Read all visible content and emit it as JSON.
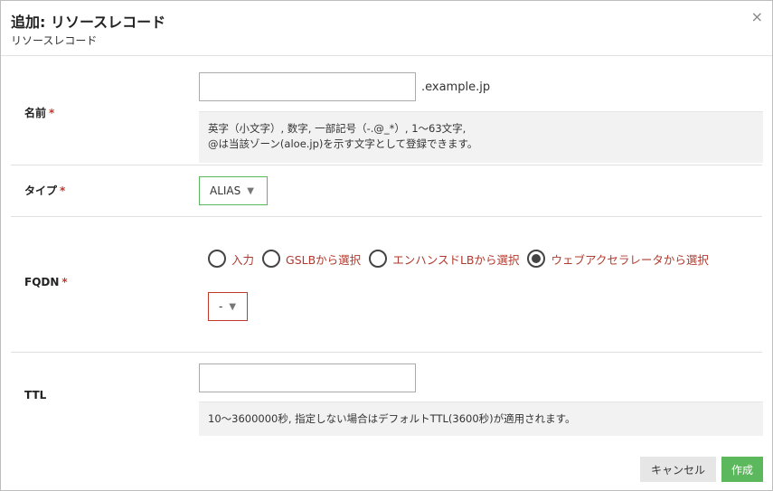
{
  "dialog": {
    "title": "追加: リソースレコード",
    "subtitle": "リソースレコード",
    "close_icon": "×"
  },
  "form": {
    "name": {
      "label": "名前",
      "required_mark": "*",
      "value": "",
      "suffix": ".example.jp",
      "help_line1": "英字（小文字）, 数字, 一部記号（-.@_*）, 1～63文字,",
      "help_line2": "@は当該ゾーン(aloe.jp)を示す文字として登録できます。"
    },
    "type": {
      "label": "タイプ",
      "required_mark": "*",
      "selected": "ALIAS",
      "arrow": "▼"
    },
    "fqdn": {
      "label": "FQDN",
      "required_mark": "*",
      "options": [
        {
          "label": "入力",
          "checked": false
        },
        {
          "label": "GSLBから選択",
          "checked": false
        },
        {
          "label": "エンハンスドLBから選択",
          "checked": false
        },
        {
          "label": "ウェブアクセラレータから選択",
          "checked": true
        }
      ],
      "select_value": "-",
      "arrow": "▼"
    },
    "ttl": {
      "label": "TTL",
      "value": "",
      "help": "10～3600000秒, 指定しない場合はデフォルトTTL(3600秒)が適用されます。"
    }
  },
  "buttons": {
    "cancel": "キャンセル",
    "create": "作成"
  },
  "colors": {
    "required": "#c0392b",
    "radio_label": "#b03a2e",
    "type_select_border": "#5cb85c",
    "fqdn_select_border": "#c0392b",
    "create_button": "#5cb85c",
    "cancel_button": "#e6e6e6"
  }
}
